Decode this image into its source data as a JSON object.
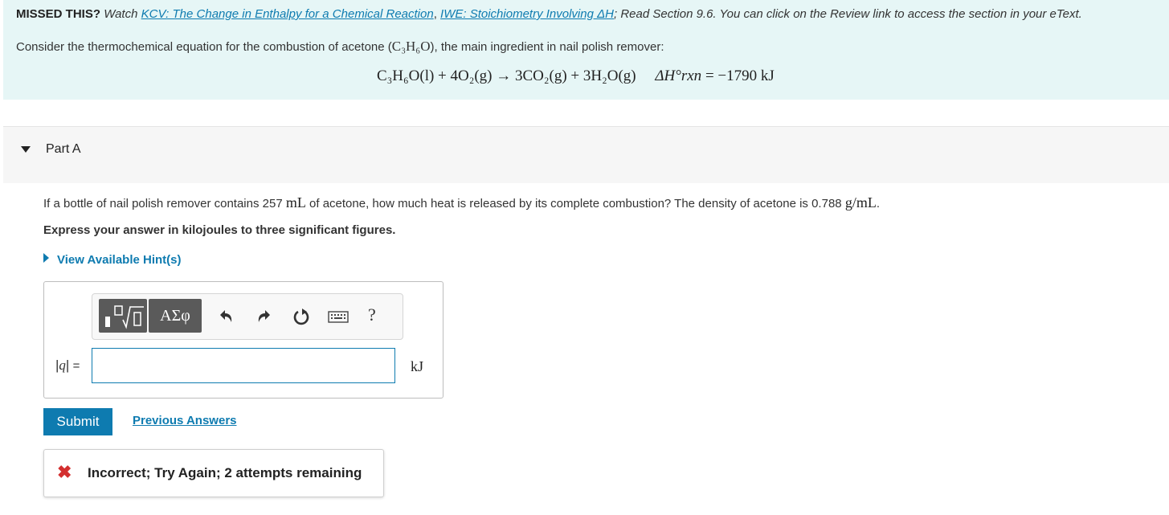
{
  "banner": {
    "missed_label": "MISSED THIS?",
    "watch_text": "Watch",
    "link1": "KCV: The Change in Enthalpy for a Chemical Reaction",
    "sep": ",",
    "link2": "IWE: Stoichiometry Involving ΔH",
    "rest": "; Read Section 9.6. You can click on the Review link to access the section in your eText.",
    "intro_pre": "Consider the thermochemical equation for the combustion of acetone (",
    "intro_formula": "C₃H₆O",
    "intro_post": "), the main ingredient in nail polish remover:",
    "equation": {
      "reactants": "C₃H₆O(l) + 4O₂(g) → 3CO₂(g) + 3H₂O(g)",
      "dh_label": "ΔH°rxn",
      "dh_value": "= −1790 kJ"
    }
  },
  "part": {
    "title": "Part A"
  },
  "question": {
    "pre": "If a bottle of nail polish remover contains 257",
    "unit1": "mL",
    "mid": "of acetone, how much heat is released by its complete combustion? The density of acetone is 0.788",
    "unit2": "g/mL",
    "post": "."
  },
  "instruction": "Express your answer in kilojoules to three significant figures.",
  "hints_label": "View Available Hint(s)",
  "toolbar": {
    "greek_label": "ΑΣφ",
    "help_label": "?"
  },
  "answer": {
    "label_var": "q",
    "label_eq": "=",
    "value": "",
    "unit": "kJ"
  },
  "submit_label": "Submit",
  "previous_answers_label": "Previous Answers",
  "feedback": {
    "icon": "✖",
    "text": "Incorrect; Try Again; 2 attempts remaining"
  },
  "colors": {
    "accent": "#0e7bb0",
    "banner_bg": "#e6f6f6",
    "error": "#d32f2f"
  }
}
